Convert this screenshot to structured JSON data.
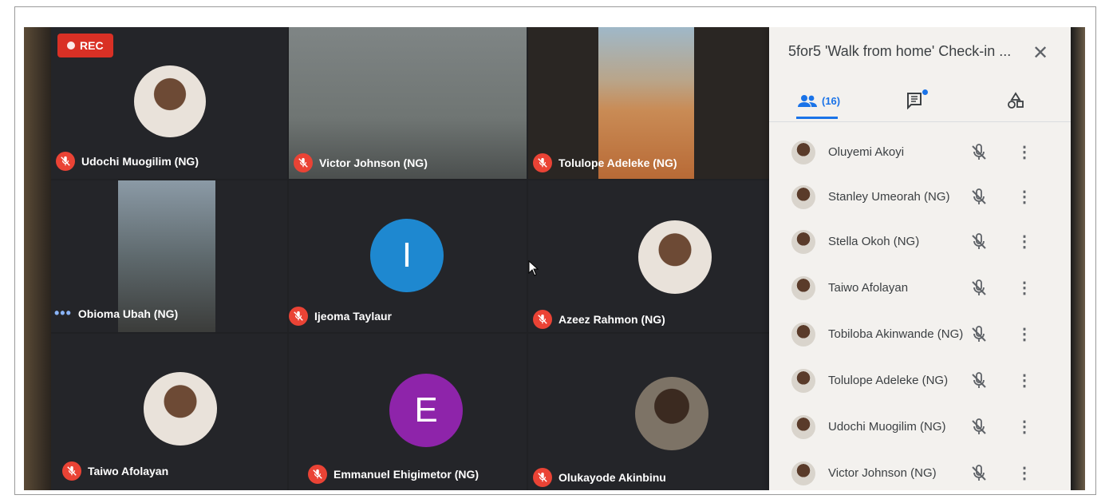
{
  "recording": {
    "label": "REC"
  },
  "tiles": [
    {
      "name": "Udochi Muogilim (NG)",
      "status": "muted"
    },
    {
      "name": "Victor Johnson (NG)",
      "status": "muted"
    },
    {
      "name": "Tolulope Adeleke (NG)",
      "status": "muted"
    },
    {
      "name": "Obioma Ubah (NG)",
      "status": "speaking",
      "indicator": "•••"
    },
    {
      "name": "Ijeoma Taylaur",
      "status": "muted",
      "avatar_letter": "I",
      "avatar_color": "#1e88d0"
    },
    {
      "name": "Azeez Rahmon (NG)",
      "status": "muted"
    },
    {
      "name": "Taiwo Afolayan",
      "status": "muted"
    },
    {
      "name": "Emmanuel Ehigimetor (NG)",
      "status": "muted",
      "avatar_letter": "E",
      "avatar_color": "#8e24aa"
    },
    {
      "name": "Olukayode Akinbinu",
      "status": "muted"
    }
  ],
  "panel": {
    "title": "5for5 'Walk from home' Check-in ...",
    "close_icon": "close-icon",
    "tabs": [
      {
        "icon": "people-icon",
        "count": "(16)",
        "selected": true
      },
      {
        "icon": "chat-icon",
        "badge": true
      },
      {
        "icon": "activities-icon"
      }
    ],
    "participants": [
      {
        "name": "Oluyemi Akoyi"
      },
      {
        "name": "Stanley Umeorah (NG)"
      },
      {
        "name": "Stella Okoh (NG)"
      },
      {
        "name": "Taiwo Afolayan"
      },
      {
        "name": "Tobiloba Akinwande (NG)"
      },
      {
        "name": "Tolulope Adeleke (NG)"
      },
      {
        "name": "Udochi Muogilim (NG)"
      },
      {
        "name": "Victor Johnson (NG)"
      }
    ]
  },
  "colors": {
    "accent": "#1a73e8",
    "mute_red": "#ea4335",
    "rec_red": "#d93025"
  }
}
